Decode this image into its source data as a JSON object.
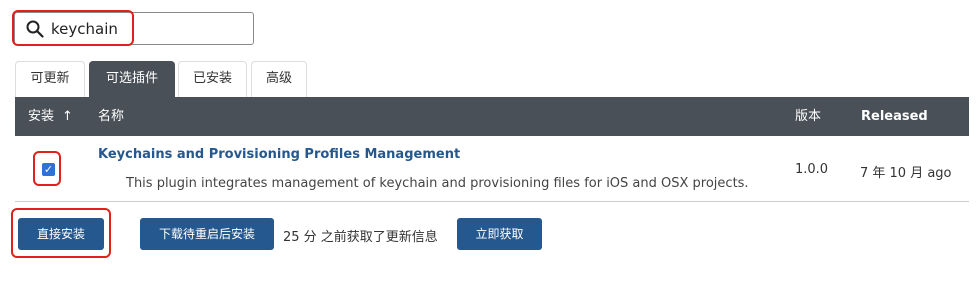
{
  "search": {
    "value": "keychain",
    "icon": "search-icon"
  },
  "tabs": [
    {
      "label": "可更新",
      "active": false
    },
    {
      "label": "可选插件",
      "active": true
    },
    {
      "label": "已安装",
      "active": false
    },
    {
      "label": "高级",
      "active": false
    }
  ],
  "table": {
    "headers": {
      "install": "安装",
      "sort_indicator": "↑",
      "name": "名称",
      "version": "版本",
      "released": "Released"
    },
    "rows": [
      {
        "checked": true,
        "name": "Keychains and Provisioning Profiles Management",
        "description": "This plugin integrates management of keychain and provisioning files for iOS and OSX projects.",
        "version": "1.0.0",
        "released": "7 年 10 月 ago"
      }
    ]
  },
  "actions": {
    "install_now": "直接安装",
    "download_restart": "下载待重启后安装",
    "status": "25 分 之前获取了更新信息",
    "check_now": "立即获取"
  },
  "colors": {
    "accent": "#25588f",
    "header_bg": "#4a5058",
    "highlight": "#e0201b",
    "checkbox": "#2b72d9"
  }
}
